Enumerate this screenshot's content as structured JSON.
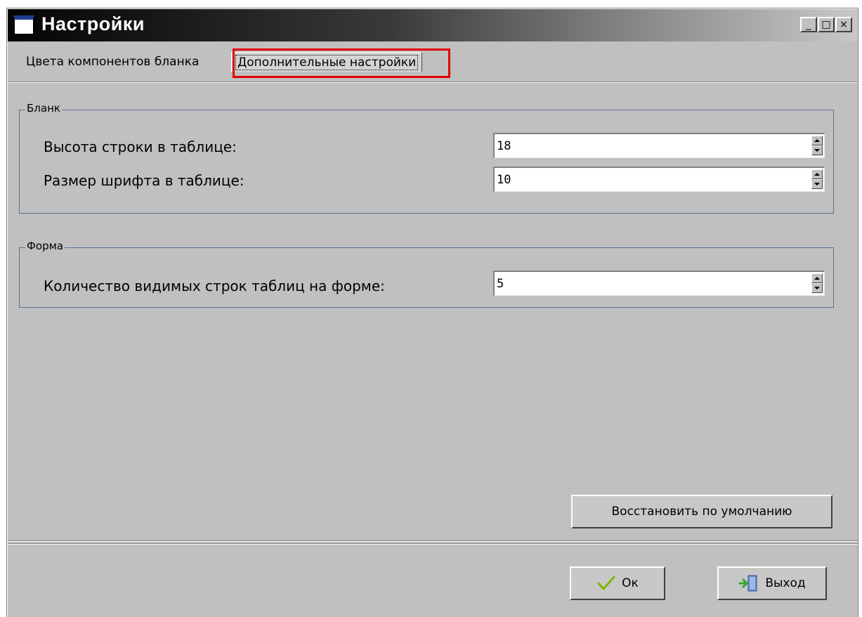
{
  "window": {
    "title": "Настройки",
    "minimize_glyph": "_",
    "maximize_glyph": "□",
    "close_glyph": "×"
  },
  "tabs": [
    {
      "label": "Цвета компонентов бланка",
      "active": false
    },
    {
      "label": "Дополнительные настройки",
      "active": true
    }
  ],
  "groups": {
    "blank": {
      "legend": "Бланк",
      "fields": [
        {
          "label": "Высота строки в таблице:",
          "value": "18"
        },
        {
          "label": "Размер шрифта в таблице:",
          "value": "10"
        }
      ]
    },
    "form": {
      "legend": "Форма",
      "fields": [
        {
          "label": "Количество видимых строк таблиц на форме:",
          "value": "5"
        }
      ]
    }
  },
  "buttons": {
    "restore_defaults": "Восстановить по умолчанию",
    "ok": "Ок",
    "exit": "Выход"
  },
  "icons": {
    "window": "window-icon",
    "ok": "checkmark-icon",
    "exit": "exit-door-icon"
  },
  "colors": {
    "highlight": "#e00000",
    "group_border": "#5a7390",
    "checkmark": "#7ab800"
  }
}
